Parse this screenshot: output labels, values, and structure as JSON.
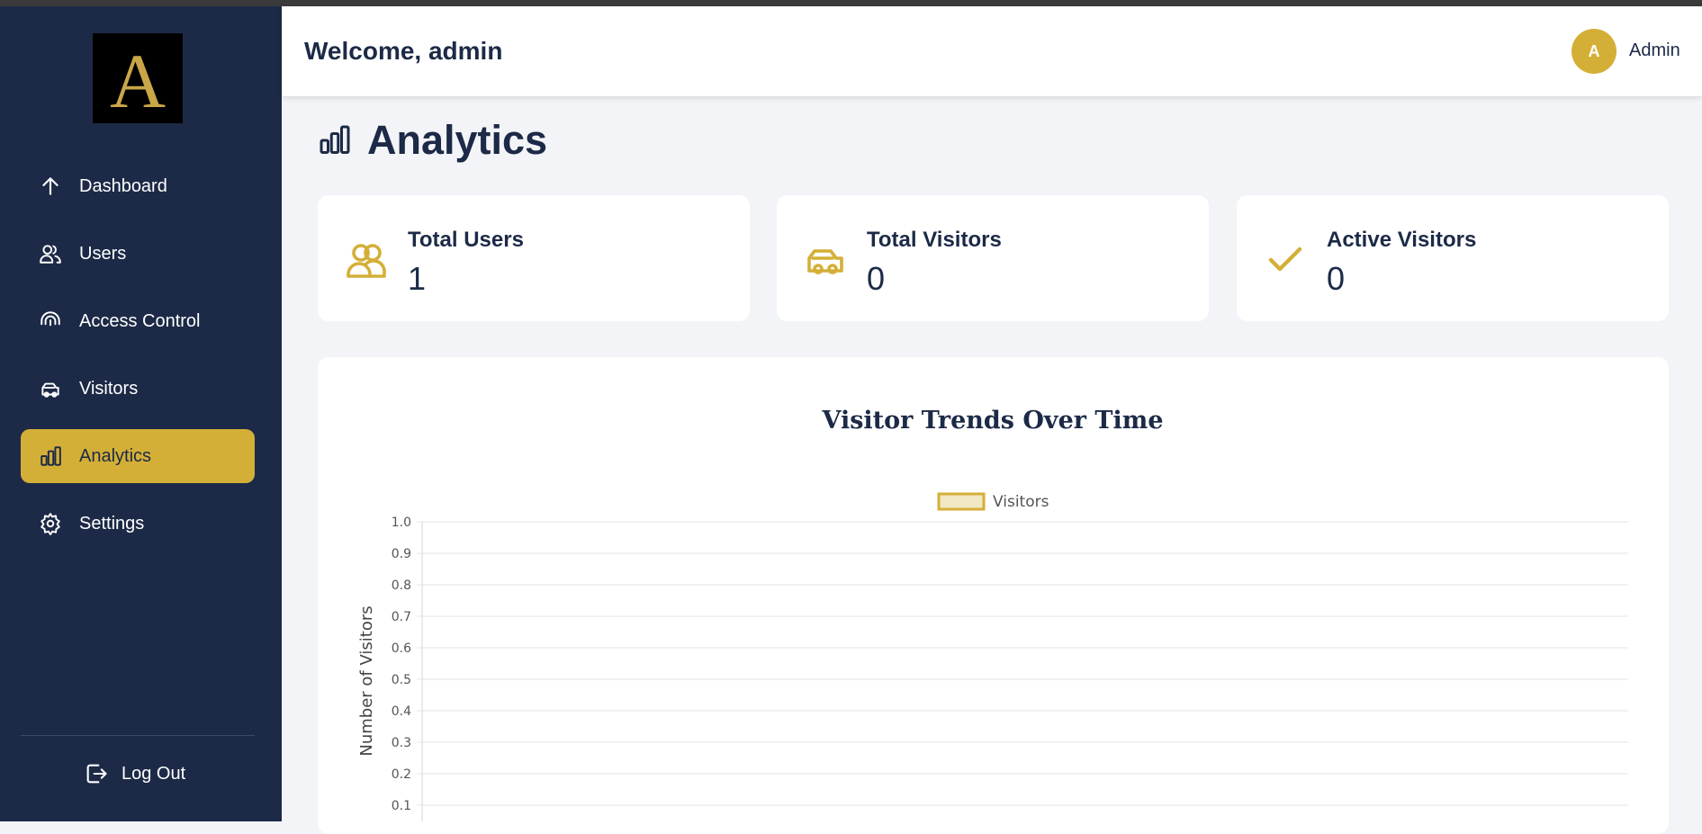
{
  "brand": {
    "logo_letter": "A"
  },
  "sidebar": {
    "items": [
      {
        "label": "Dashboard",
        "icon": "arrow-up-icon"
      },
      {
        "label": "Users",
        "icon": "users-icon"
      },
      {
        "label": "Access Control",
        "icon": "fingerprint-icon"
      },
      {
        "label": "Visitors",
        "icon": "car-icon"
      },
      {
        "label": "Analytics",
        "icon": "bar-chart-icon",
        "active": true
      },
      {
        "label": "Settings",
        "icon": "gear-icon"
      }
    ],
    "logout_label": "Log Out"
  },
  "header": {
    "welcome": "Welcome, admin",
    "avatar_initial": "A",
    "user_name": "Admin"
  },
  "page": {
    "title": "Analytics"
  },
  "stats": [
    {
      "label": "Total Users",
      "value": "1",
      "icon": "users-icon"
    },
    {
      "label": "Total Visitors",
      "value": "0",
      "icon": "car-icon"
    },
    {
      "label": "Active Visitors",
      "value": "0",
      "icon": "check-icon"
    }
  ],
  "colors": {
    "sidebar": "#1c2a47",
    "accent": "#d4af37",
    "background": "#f3f4f7"
  },
  "chart_data": {
    "type": "bar",
    "title": "Visitor Trends Over Time",
    "series": [
      {
        "name": "Visitors",
        "values": []
      }
    ],
    "categories": [],
    "ylabel": "Number of Visitors",
    "xlabel": "",
    "y_ticks": [
      "1.0",
      "0.9",
      "0.8",
      "0.7",
      "0.6",
      "0.5",
      "0.4",
      "0.3",
      "0.2",
      "0.1"
    ],
    "ylim": [
      0,
      1
    ],
    "grid": true,
    "legend_position": "top"
  }
}
